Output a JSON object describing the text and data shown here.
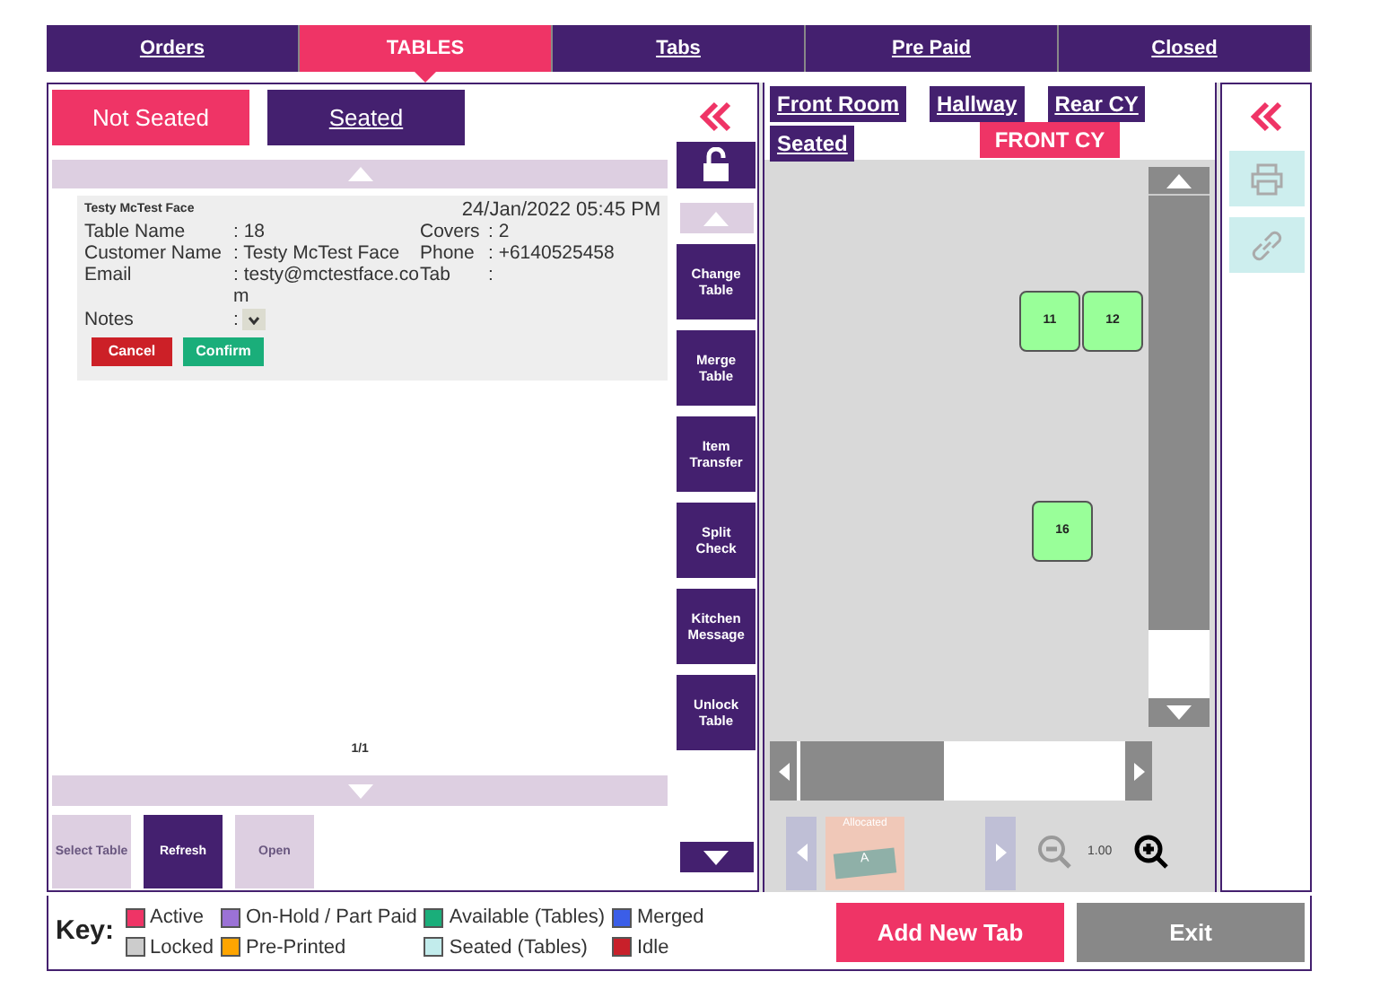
{
  "top_tabs": [
    {
      "label": "Orders",
      "selected": false
    },
    {
      "label": "TABLES",
      "selected": true
    },
    {
      "label": "Tabs",
      "selected": false
    },
    {
      "label": "Pre Paid",
      "selected": false
    },
    {
      "label": "Closed",
      "selected": false
    }
  ],
  "filter_tabs": [
    {
      "label": "Not Seated",
      "selected": true
    },
    {
      "label": "Seated",
      "selected": false
    }
  ],
  "order_card": {
    "name": "Testy McTest Face",
    "date": "24/Jan/2022 05:45 PM",
    "fields": [
      {
        "label": "Table Name",
        "value": ": 18",
        "label_2": "Covers",
        "value_2": ": 2"
      },
      {
        "label": "Customer Name",
        "value": ": Testy McTest Face",
        "label_2": "Phone",
        "value_2": ": +6140525458"
      },
      {
        "label": "Email",
        "value": ": testy@mctestface.co m",
        "label_2": "Tab",
        "value_2": ":"
      }
    ],
    "notes_label": "Notes",
    "notes_sep": ":",
    "buttons": [
      {
        "label": "Cancel",
        "kind": "danger"
      },
      {
        "label": "Confirm",
        "kind": "ok"
      }
    ]
  },
  "pager": "1/1",
  "bottom_buttons": [
    {
      "label": "Select Table",
      "disabled": true
    },
    {
      "label": "Refresh",
      "disabled": false
    },
    {
      "label": "Open",
      "disabled": true
    }
  ],
  "actions": [
    "Change Table",
    "Merge Table",
    "Item Transfer",
    "Split Check",
    "Kitchen Message",
    "Unlock Table"
  ],
  "areas": [
    {
      "label": "Front Room",
      "selected": false
    },
    {
      "label": "Hallway",
      "selected": false
    },
    {
      "label": "Rear CY",
      "selected": false
    },
    {
      "label": "Seated",
      "selected": false
    },
    {
      "label": "FRONT CY",
      "selected": true
    }
  ],
  "floor_tables": [
    {
      "label": "11",
      "color": "#99ff99"
    },
    {
      "label": "12",
      "color": "#99ff99"
    },
    {
      "label": "16",
      "color": "#99ff99"
    }
  ],
  "allocated": {
    "label": "Allocated",
    "tag": "A"
  },
  "zoom": "1.00",
  "key": {
    "label": "Key:",
    "items": [
      {
        "label": "Active",
        "color": "#ef3466"
      },
      {
        "label": "Locked",
        "color": "#cccccc"
      },
      {
        "label": "On-Hold / Part Paid",
        "color": "#9b72d6"
      },
      {
        "label": "Pre-Printed",
        "color": "#ffa500"
      },
      {
        "label": "Available (Tables)",
        "color": "#1aae7a"
      },
      {
        "label": "Seated (Tables)",
        "color": "#c2ecec"
      },
      {
        "label": "Merged",
        "color": "#3b5ee8"
      },
      {
        "label": "Idle",
        "color": "#c8202a"
      }
    ]
  },
  "add_button": "Add New Tab",
  "exit_button": "Exit"
}
